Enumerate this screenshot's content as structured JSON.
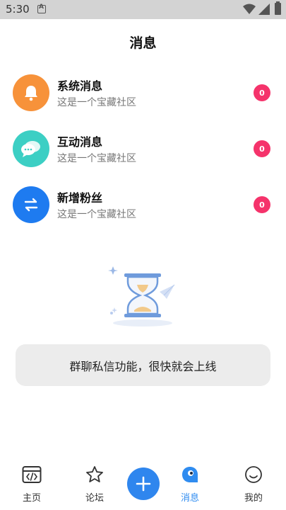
{
  "status_bar": {
    "time": "5:30",
    "notification_letter": "A"
  },
  "page": {
    "title": "消息"
  },
  "messages": [
    {
      "title": "系统消息",
      "subtitle": "这是一个宝藏社区",
      "badge": "0",
      "icon": "bell-icon",
      "color": "#f7923a"
    },
    {
      "title": "互动消息",
      "subtitle": "这是一个宝藏社区",
      "badge": "0",
      "icon": "chat-bubbles-icon",
      "color": "#3ccfc4"
    },
    {
      "title": "新增粉丝",
      "subtitle": "这是一个宝藏社区",
      "badge": "0",
      "icon": "swap-arrows-icon",
      "color": "#1e7bf0"
    }
  ],
  "empty_state": {
    "toast": "群聊私信功能，很快就会上线",
    "illustration": "hourglass-icon"
  },
  "tabs": [
    {
      "label": "主页",
      "icon": "code-window-icon",
      "active": false
    },
    {
      "label": "论坛",
      "icon": "star-icon",
      "active": false
    },
    {
      "label": "消息",
      "icon": "chat-blob-icon",
      "active": true
    },
    {
      "label": "我的",
      "icon": "smiley-icon",
      "active": false
    }
  ],
  "fab": {
    "icon": "plus-icon"
  },
  "colors": {
    "accent": "#2f86ee",
    "badge": "#f5336b",
    "toast_bg": "#ececec"
  }
}
